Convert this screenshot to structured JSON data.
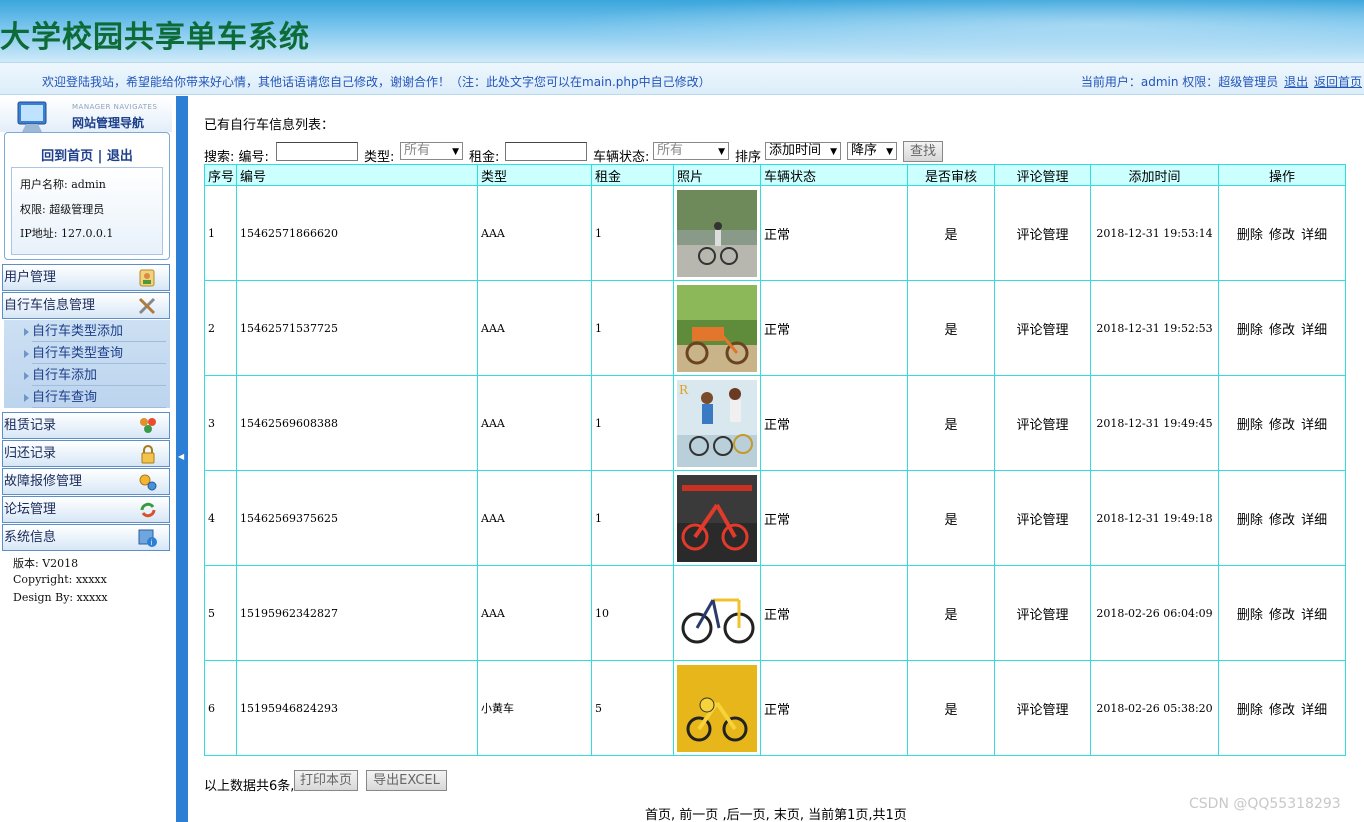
{
  "header": {
    "title": "大学校园共享单车系统",
    "welcome": "欢迎登陆我站，希望能给你带来好心情，其他话语请您自己修改，谢谢合作！（注：此处文字您可以在main.php中自己修改）",
    "current_user": "当前用户：admin 权限：超级管理员",
    "logout": "退出",
    "back_home": "返回首页"
  },
  "sidebar": {
    "nav_subtitle": "MANAGER NAVIGATES",
    "nav_title": "网站管理导航",
    "home_link": "回到首页",
    "separator": "|",
    "exit_link": "退出",
    "info": {
      "username": "用户名称: admin",
      "role": "权限: 超级管理员",
      "ip": "IP地址: 127.0.0.1"
    },
    "menus": [
      {
        "label": "用户管理",
        "icon": "user-edit-icon"
      },
      {
        "label": "自行车信息管理",
        "icon": "tools-icon"
      },
      {
        "label": "租赁记录",
        "icon": "users-group-icon"
      },
      {
        "label": "归还记录",
        "icon": "lock-icon"
      },
      {
        "label": "故障报修管理",
        "icon": "gears-icon"
      },
      {
        "label": "论坛管理",
        "icon": "refresh-icon"
      },
      {
        "label": "系统信息",
        "icon": "info-icon"
      }
    ],
    "submenu": [
      "自行车类型添加",
      "自行车类型查询",
      "自行车添加",
      "自行车查询"
    ],
    "footer": {
      "version": "版本:  V2018",
      "copyright": "Copyright: xxxxx",
      "design": "Design By:  xxxxx"
    }
  },
  "main": {
    "list_title": "已有自行车信息列表：",
    "search": {
      "label": "搜索: 编号:",
      "type_label": "类型:",
      "type_value": "所有",
      "rent_label": "租金:",
      "status_label": "车辆状态:",
      "status_value": "所有",
      "sort_label": "排序",
      "sort_field": "添加时间",
      "sort_order": "降序",
      "search_button": "查找"
    },
    "columns": [
      "序号",
      "编号",
      "类型",
      "租金",
      "照片",
      "车辆状态",
      "是否审核",
      "评论管理",
      "添加时间",
      "操作"
    ],
    "rows": [
      {
        "index": "1",
        "code": "15462571866620",
        "type": "AAA",
        "rent": "1",
        "status": "正常",
        "audited": "是",
        "comment": "评论管理",
        "time": "2018-12-31 19:53:14",
        "photo": "cyclist-street"
      },
      {
        "index": "2",
        "code": "15462571537725",
        "type": "AAA",
        "rent": "1",
        "status": "正常",
        "audited": "是",
        "comment": "评论管理",
        "time": "2018-12-31 19:52:53",
        "photo": "orange-cargo-bike"
      },
      {
        "index": "3",
        "code": "15462569608388",
        "type": "AAA",
        "rent": "1",
        "status": "正常",
        "audited": "是",
        "comment": "评论管理",
        "time": "2018-12-31 19:49:45",
        "photo": "two-riders"
      },
      {
        "index": "4",
        "code": "15462569375625",
        "type": "AAA",
        "rent": "1",
        "status": "正常",
        "audited": "是",
        "comment": "评论管理",
        "time": "2018-12-31 19:49:18",
        "photo": "red-shared-bikes"
      },
      {
        "index": "5",
        "code": "15195962342827",
        "type": "AAA",
        "rent": "10",
        "status": "正常",
        "audited": "是",
        "comment": "评论管理",
        "time": "2018-02-26 06:04:09",
        "photo": "yellow-road-bike"
      },
      {
        "index": "6",
        "code": "15195946824293",
        "type": "小黄车",
        "rent": "5",
        "status": "正常",
        "audited": "是",
        "comment": "评论管理",
        "time": "2018-02-26 05:38:20",
        "photo": "yellow-kids-bike"
      }
    ],
    "ops": {
      "delete": "删除",
      "edit": "修改",
      "detail": "详细"
    },
    "total": "以上数据共6条,",
    "print_button": "打印本页",
    "export_button": "导出EXCEL",
    "pager": {
      "first": "首页,",
      "prev": "前一页",
      "next": ",后一页,",
      "last": "末页,",
      "info": "当前第1页,共1页"
    }
  },
  "watermark": "CSDN @QQ55318293"
}
